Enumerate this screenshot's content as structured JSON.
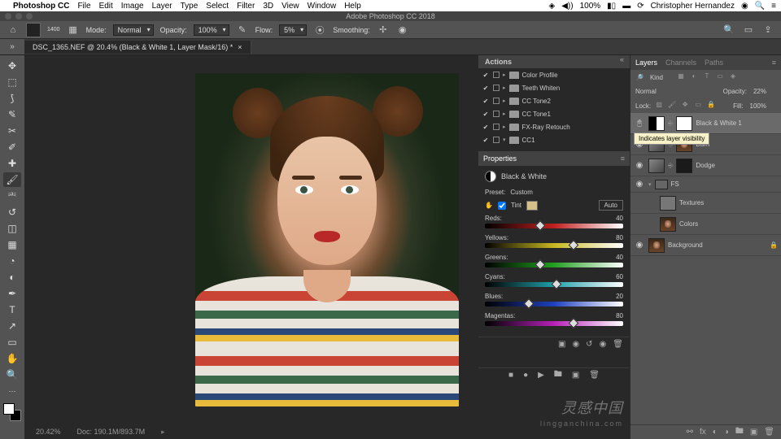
{
  "menubar": {
    "apple": "",
    "app": "Photoshop CC",
    "items": [
      "File",
      "Edit",
      "Image",
      "Layer",
      "Type",
      "Select",
      "Filter",
      "3D",
      "View",
      "Window",
      "Help"
    ],
    "battery": "100%",
    "user": "Christopher Hernandez"
  },
  "window": {
    "title": "Adobe Photoshop CC 2018"
  },
  "options": {
    "size": "1400",
    "mode_label": "Mode:",
    "mode": "Normal",
    "opacity_label": "Opacity:",
    "opacity": "100%",
    "flow_label": "Flow:",
    "flow": "5%",
    "smoothing_label": "Smoothing:"
  },
  "document": {
    "tab": "DSC_1365.NEF @ 20.4% (Black & White 1, Layer Mask/16) *",
    "zoom": "20.42%",
    "docinfo": "Doc: 190.1M/893.7M"
  },
  "actions": {
    "title": "Actions",
    "items": [
      {
        "name": "Color Profile"
      },
      {
        "name": "Teeth Whiten"
      },
      {
        "name": "CC Tone2"
      },
      {
        "name": "CC Tone1"
      },
      {
        "name": "FX-Ray Retouch"
      },
      {
        "name": "CC1"
      }
    ]
  },
  "properties": {
    "title": "Properties",
    "adjustment": "Black & White",
    "preset_label": "Preset:",
    "preset": "Custom",
    "tint_label": "Tint",
    "auto": "Auto",
    "sliders": {
      "reds": {
        "label": "Reds:",
        "value": "40",
        "pct": 40
      },
      "yellows": {
        "label": "Yellows:",
        "value": "80",
        "pct": 64
      },
      "greens": {
        "label": "Greens:",
        "value": "40",
        "pct": 40
      },
      "cyans": {
        "label": "Cyans:",
        "value": "60",
        "pct": 52
      },
      "blues": {
        "label": "Blues:",
        "value": "20",
        "pct": 32
      },
      "magentas": {
        "label": "Magentas:",
        "value": "80",
        "pct": 64
      }
    }
  },
  "layers": {
    "tabs": [
      "Layers",
      "Channels",
      "Paths"
    ],
    "kind": "Kind",
    "blend": "Normal",
    "opacity_label": "Opacity:",
    "opacity": "22%",
    "lock_label": "Lock:",
    "fill_label": "Fill:",
    "fill": "100%",
    "items": [
      {
        "name": "Black & White 1",
        "type": "adj-bw",
        "selected": true
      },
      {
        "name": "Burn",
        "type": "curves"
      },
      {
        "name": "Dodge",
        "type": "curves"
      },
      {
        "name": "FS",
        "type": "group"
      },
      {
        "name": "Textures",
        "type": "layer"
      },
      {
        "name": "Colors",
        "type": "image"
      },
      {
        "name": "Background",
        "type": "image",
        "locked": true
      }
    ],
    "tooltip": "Indicates layer visibility"
  },
  "watermark": {
    "main": "灵感中国",
    "sub": "lingganchina.com"
  }
}
